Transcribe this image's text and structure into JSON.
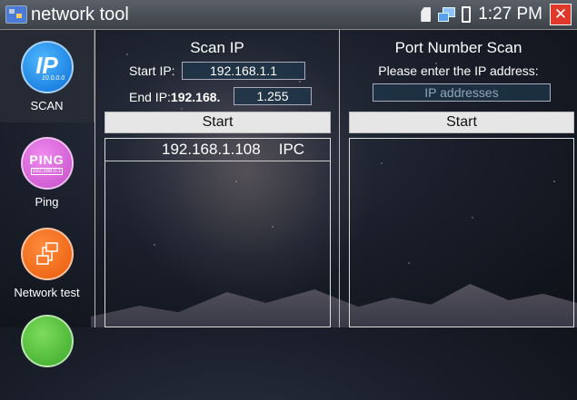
{
  "title_bar": {
    "app_title": "network tool",
    "icons": [
      "sd-card-icon",
      "network-icon",
      "battery-icon"
    ],
    "time": "1:27 PM",
    "close_label": "✕"
  },
  "sidebar": {
    "items": [
      {
        "label": "SCAN",
        "icon": "scan-ip-icon",
        "glyph": "IP",
        "glyph_sub": "10.0.0.0",
        "active": true
      },
      {
        "label": "Ping",
        "icon": "ping-icon",
        "glyph": "PING",
        "glyph_sub": "192.168.0.1",
        "active": false
      },
      {
        "label": "Network test",
        "icon": "network-test-icon",
        "active": false
      },
      {
        "label": "",
        "icon": "green-tool-icon",
        "active": false
      }
    ]
  },
  "scan_ip": {
    "title": "Scan IP",
    "start_ip_label": "Start IP:",
    "start_ip_value": "192.168.1.1",
    "end_ip_label": "End IP:",
    "end_ip_prefix": "192.168.",
    "end_ip_value": "1.255",
    "start_button": "Start",
    "results": [
      {
        "ip": "192.168.1.108",
        "type": "IPC"
      }
    ]
  },
  "port_scan": {
    "title": "Port Number Scan",
    "prompt": "Please enter the IP address:",
    "ip_placeholder": "IP addresses",
    "start_button": "Start"
  },
  "colors": {
    "titlebar": "#4a4f56",
    "close": "#e0392b",
    "scan_icon": "#1d8ef0",
    "ping_icon": "#d45fd6",
    "network_icon": "#f0701e",
    "green_icon": "#4cbf34"
  }
}
